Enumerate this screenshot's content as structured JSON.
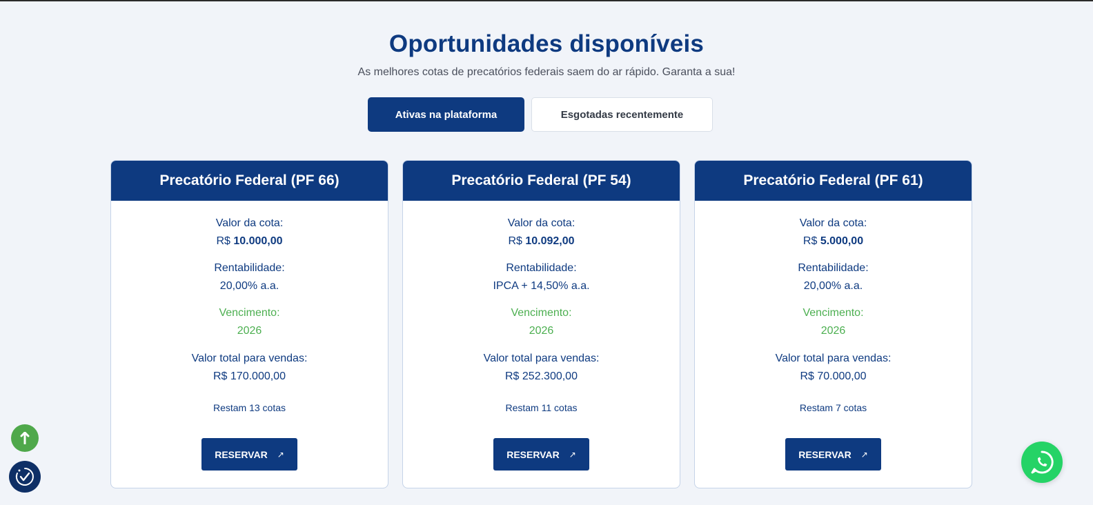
{
  "header": {
    "title": "Oportunidades disponíveis",
    "subtitle": "As melhores cotas de precatórios federais saem do ar rápido. Garanta a sua!"
  },
  "tabs": [
    {
      "label": "Ativas na plataforma",
      "active": true
    },
    {
      "label": "Esgotadas recentemente",
      "active": false
    }
  ],
  "cards": [
    {
      "title": "Precatório Federal (PF 66)",
      "quota_label": "Valor da cota:",
      "quota_currency": "R$",
      "quota_value": "10.000,00",
      "yield_label": "Rentabilidade:",
      "yield_value": "20,00% a.a.",
      "maturity_label": "Vencimento:",
      "maturity_value": "2026",
      "total_label": "Valor total para vendas:",
      "total_value": "R$ 170.000,00",
      "remaining": "Restam 13 cotas",
      "button": "RESERVAR"
    },
    {
      "title": "Precatório Federal (PF 54)",
      "quota_label": "Valor da cota:",
      "quota_currency": "R$",
      "quota_value": "10.092,00",
      "yield_label": "Rentabilidade:",
      "yield_value": "IPCA + 14,50% a.a.",
      "maturity_label": "Vencimento:",
      "maturity_value": "2026",
      "total_label": "Valor total para vendas:",
      "total_value": "R$ 252.300,00",
      "remaining": "Restam 11 cotas",
      "button": "RESERVAR"
    },
    {
      "title": "Precatório Federal (PF 61)",
      "quota_label": "Valor da cota:",
      "quota_currency": "R$",
      "quota_value": "5.000,00",
      "yield_label": "Rentabilidade:",
      "yield_value": "20,00% a.a.",
      "maturity_label": "Vencimento:",
      "maturity_value": "2026",
      "total_label": "Valor total para vendas:",
      "total_value": "R$ 70.000,00",
      "remaining": "Restam 7 cotas",
      "button": "RESERVAR"
    }
  ],
  "floating": {
    "scroll_top_icon": "arrow-up-icon",
    "badge_icon": "check-badge-icon",
    "whatsapp_icon": "whatsapp-icon"
  },
  "colors": {
    "primary": "#0e3a80",
    "green": "#4caf50",
    "background": "#f1f4f9",
    "whatsapp": "#25d366"
  }
}
